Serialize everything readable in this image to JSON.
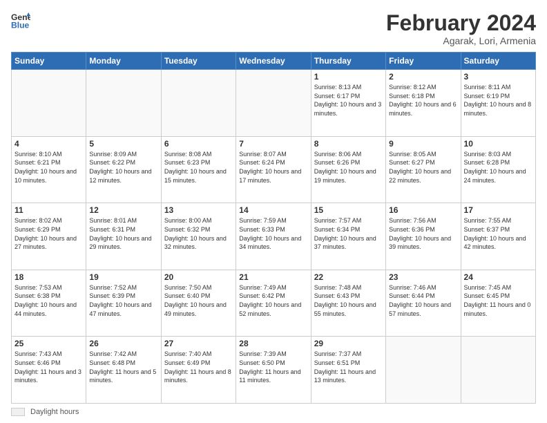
{
  "header": {
    "logo_general": "General",
    "logo_blue": "Blue",
    "month": "February 2024",
    "location": "Agarak, Lori, Armenia"
  },
  "days_of_week": [
    "Sunday",
    "Monday",
    "Tuesday",
    "Wednesday",
    "Thursday",
    "Friday",
    "Saturday"
  ],
  "weeks": [
    [
      {
        "day": "",
        "info": ""
      },
      {
        "day": "",
        "info": ""
      },
      {
        "day": "",
        "info": ""
      },
      {
        "day": "",
        "info": ""
      },
      {
        "day": "1",
        "info": "Sunrise: 8:13 AM\nSunset: 6:17 PM\nDaylight: 10 hours\nand 3 minutes."
      },
      {
        "day": "2",
        "info": "Sunrise: 8:12 AM\nSunset: 6:18 PM\nDaylight: 10 hours\nand 6 minutes."
      },
      {
        "day": "3",
        "info": "Sunrise: 8:11 AM\nSunset: 6:19 PM\nDaylight: 10 hours\nand 8 minutes."
      }
    ],
    [
      {
        "day": "4",
        "info": "Sunrise: 8:10 AM\nSunset: 6:21 PM\nDaylight: 10 hours\nand 10 minutes."
      },
      {
        "day": "5",
        "info": "Sunrise: 8:09 AM\nSunset: 6:22 PM\nDaylight: 10 hours\nand 12 minutes."
      },
      {
        "day": "6",
        "info": "Sunrise: 8:08 AM\nSunset: 6:23 PM\nDaylight: 10 hours\nand 15 minutes."
      },
      {
        "day": "7",
        "info": "Sunrise: 8:07 AM\nSunset: 6:24 PM\nDaylight: 10 hours\nand 17 minutes."
      },
      {
        "day": "8",
        "info": "Sunrise: 8:06 AM\nSunset: 6:26 PM\nDaylight: 10 hours\nand 19 minutes."
      },
      {
        "day": "9",
        "info": "Sunrise: 8:05 AM\nSunset: 6:27 PM\nDaylight: 10 hours\nand 22 minutes."
      },
      {
        "day": "10",
        "info": "Sunrise: 8:03 AM\nSunset: 6:28 PM\nDaylight: 10 hours\nand 24 minutes."
      }
    ],
    [
      {
        "day": "11",
        "info": "Sunrise: 8:02 AM\nSunset: 6:29 PM\nDaylight: 10 hours\nand 27 minutes."
      },
      {
        "day": "12",
        "info": "Sunrise: 8:01 AM\nSunset: 6:31 PM\nDaylight: 10 hours\nand 29 minutes."
      },
      {
        "day": "13",
        "info": "Sunrise: 8:00 AM\nSunset: 6:32 PM\nDaylight: 10 hours\nand 32 minutes."
      },
      {
        "day": "14",
        "info": "Sunrise: 7:59 AM\nSunset: 6:33 PM\nDaylight: 10 hours\nand 34 minutes."
      },
      {
        "day": "15",
        "info": "Sunrise: 7:57 AM\nSunset: 6:34 PM\nDaylight: 10 hours\nand 37 minutes."
      },
      {
        "day": "16",
        "info": "Sunrise: 7:56 AM\nSunset: 6:36 PM\nDaylight: 10 hours\nand 39 minutes."
      },
      {
        "day": "17",
        "info": "Sunrise: 7:55 AM\nSunset: 6:37 PM\nDaylight: 10 hours\nand 42 minutes."
      }
    ],
    [
      {
        "day": "18",
        "info": "Sunrise: 7:53 AM\nSunset: 6:38 PM\nDaylight: 10 hours\nand 44 minutes."
      },
      {
        "day": "19",
        "info": "Sunrise: 7:52 AM\nSunset: 6:39 PM\nDaylight: 10 hours\nand 47 minutes."
      },
      {
        "day": "20",
        "info": "Sunrise: 7:50 AM\nSunset: 6:40 PM\nDaylight: 10 hours\nand 49 minutes."
      },
      {
        "day": "21",
        "info": "Sunrise: 7:49 AM\nSunset: 6:42 PM\nDaylight: 10 hours\nand 52 minutes."
      },
      {
        "day": "22",
        "info": "Sunrise: 7:48 AM\nSunset: 6:43 PM\nDaylight: 10 hours\nand 55 minutes."
      },
      {
        "day": "23",
        "info": "Sunrise: 7:46 AM\nSunset: 6:44 PM\nDaylight: 10 hours\nand 57 minutes."
      },
      {
        "day": "24",
        "info": "Sunrise: 7:45 AM\nSunset: 6:45 PM\nDaylight: 11 hours\nand 0 minutes."
      }
    ],
    [
      {
        "day": "25",
        "info": "Sunrise: 7:43 AM\nSunset: 6:46 PM\nDaylight: 11 hours\nand 3 minutes."
      },
      {
        "day": "26",
        "info": "Sunrise: 7:42 AM\nSunset: 6:48 PM\nDaylight: 11 hours\nand 5 minutes."
      },
      {
        "day": "27",
        "info": "Sunrise: 7:40 AM\nSunset: 6:49 PM\nDaylight: 11 hours\nand 8 minutes."
      },
      {
        "day": "28",
        "info": "Sunrise: 7:39 AM\nSunset: 6:50 PM\nDaylight: 11 hours\nand 11 minutes."
      },
      {
        "day": "29",
        "info": "Sunrise: 7:37 AM\nSunset: 6:51 PM\nDaylight: 11 hours\nand 13 minutes."
      },
      {
        "day": "",
        "info": ""
      },
      {
        "day": "",
        "info": ""
      }
    ]
  ],
  "legend": {
    "label": "Daylight hours"
  }
}
